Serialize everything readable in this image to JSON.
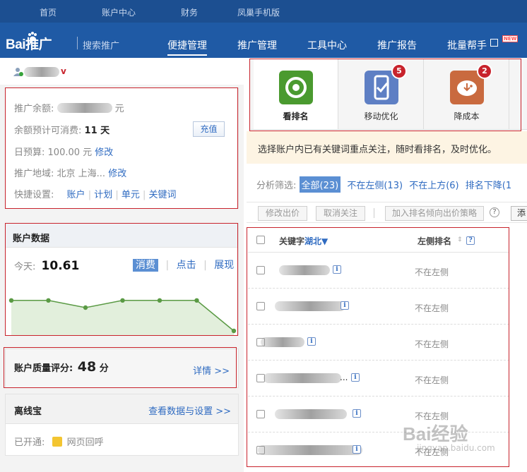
{
  "topbar": {
    "items": [
      "首页",
      "账户中心",
      "财务",
      "凤巢手机版"
    ]
  },
  "nav": {
    "logo": "Bai推广",
    "logo_sub": "搜索推广",
    "items": [
      "便捷管理",
      "推广管理",
      "工具中心",
      "推广报告",
      "批量帮手"
    ],
    "active_index": 0,
    "new_badge": "NEW"
  },
  "account": {
    "vip_mark": "v",
    "balance_label": "推广余额:",
    "balance_unit": "元",
    "days_label": "余额预计可消费:",
    "days_value": "11 天",
    "recharge": "充值",
    "budget_label": "日预算:",
    "budget_value": "100.00 元",
    "budget_edit": "修改",
    "region_label": "推广地域:",
    "region_value": "北京 上海...",
    "region_edit": "修改",
    "shortcut_label": "快捷设置:",
    "shortcuts": [
      "账户",
      "计划",
      "单元",
      "关键词"
    ]
  },
  "account_data": {
    "title": "账户数据",
    "today_label": "今天:",
    "today_value": "10.61",
    "tabs": [
      "消费",
      "点击",
      "展现"
    ],
    "active_tab": 0,
    "sparkline": [
      0.72,
      0.72,
      0.55,
      0.72,
      0.72,
      0.72,
      0.0
    ]
  },
  "quality": {
    "label": "账户质量评分:",
    "score": "48",
    "unit": "分",
    "detail": "详情 >>"
  },
  "offline": {
    "title": "离线宝",
    "link": "查看数据与设置 >>",
    "enabled_label": "已开通:",
    "enabled_value": "网页回呼"
  },
  "tools": [
    {
      "label": "看排名",
      "badge": "",
      "color": "#4a9a2f"
    },
    {
      "label": "移动优化",
      "badge": "5",
      "color": "#5e7fc4"
    },
    {
      "label": "降成本",
      "badge": "2",
      "color": "#c96a3f"
    }
  ],
  "notice": "选择账户内已有关键词重点关注，随时看排名，及时优化。",
  "filter": {
    "label": "分析筛选:",
    "active": "全部(23)",
    "options": [
      "不在左侧(13)",
      "不在上方(6)",
      "排名下降(1"
    ]
  },
  "toolbar": {
    "modify_bid": "修改出价",
    "cancel_focus": "取消关注",
    "add_strategy": "加入排名倾向出价策略",
    "help": "?",
    "add": "添"
  },
  "table": {
    "col_keyword": "关键字",
    "col_keyword_sort": "湖北▼",
    "col_rank": "左侧排名",
    "rows": [
      {
        "rank": "不在左侧",
        "suffix": ""
      },
      {
        "rank": "不在左侧",
        "suffix": ""
      },
      {
        "rank": "不在左侧",
        "suffix": ""
      },
      {
        "rank": "不在左侧",
        "suffix": "..."
      },
      {
        "rank": "不在左侧",
        "suffix": ""
      },
      {
        "rank": "不在左侧",
        "suffix": ""
      }
    ]
  },
  "watermark": "Bai经验",
  "watermark_sub": "jingyan.baidu.com"
}
